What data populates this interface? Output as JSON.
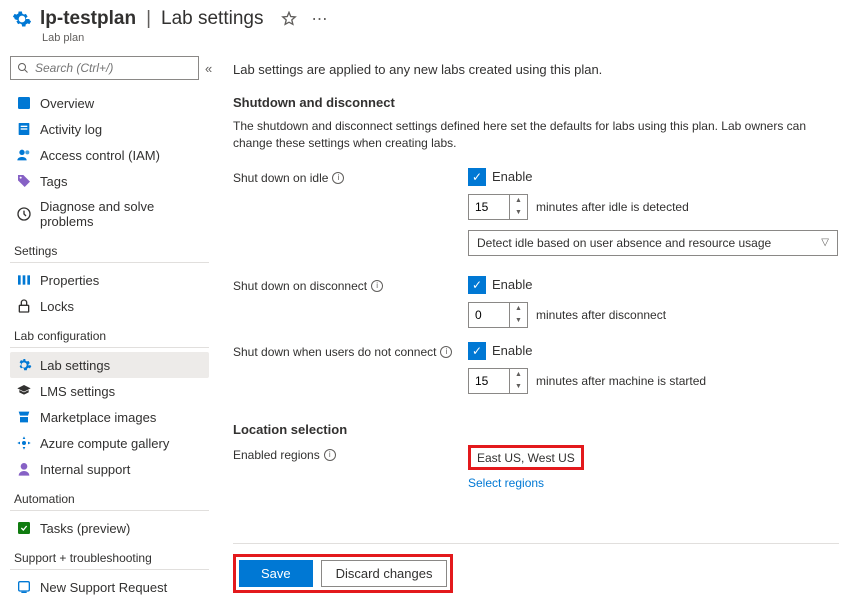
{
  "header": {
    "name": "lp-testplan",
    "section": "Lab settings",
    "resourceType": "Lab plan"
  },
  "search": {
    "placeholder": "Search (Ctrl+/)"
  },
  "sidebar": {
    "top": [
      {
        "label": "Overview",
        "icon": "overview"
      },
      {
        "label": "Activity log",
        "icon": "activity"
      },
      {
        "label": "Access control (IAM)",
        "icon": "access"
      },
      {
        "label": "Tags",
        "icon": "tags"
      },
      {
        "label": "Diagnose and solve problems",
        "icon": "diagnose"
      }
    ],
    "groups": [
      {
        "title": "Settings",
        "items": [
          {
            "label": "Properties",
            "icon": "properties"
          },
          {
            "label": "Locks",
            "icon": "locks"
          }
        ]
      },
      {
        "title": "Lab configuration",
        "items": [
          {
            "label": "Lab settings",
            "icon": "labsettings",
            "selected": true
          },
          {
            "label": "LMS settings",
            "icon": "lms"
          },
          {
            "label": "Marketplace images",
            "icon": "marketplace"
          },
          {
            "label": "Azure compute gallery",
            "icon": "gallery"
          },
          {
            "label": "Internal support",
            "icon": "support"
          }
        ]
      },
      {
        "title": "Automation",
        "items": [
          {
            "label": "Tasks (preview)",
            "icon": "tasks"
          }
        ]
      },
      {
        "title": "Support + troubleshooting",
        "items": [
          {
            "label": "New Support Request",
            "icon": "newsupport"
          }
        ]
      }
    ]
  },
  "main": {
    "intro": "Lab settings are applied to any new labs created using this plan.",
    "shutdown": {
      "head": "Shutdown and disconnect",
      "desc": "The shutdown and disconnect settings defined here set the defaults for labs using this plan. Lab owners can change these settings when creating labs.",
      "idle": {
        "label": "Shut down on idle",
        "enable": "Enable",
        "minutes": "15",
        "after": "minutes after idle is detected",
        "dropdown": "Detect idle based on user absence and resource usage"
      },
      "disconnect": {
        "label": "Shut down on disconnect",
        "enable": "Enable",
        "minutes": "0",
        "after": "minutes after disconnect"
      },
      "noconnect": {
        "label": "Shut down when users do not connect",
        "enable": "Enable",
        "minutes": "15",
        "after": "minutes after machine is started"
      }
    },
    "location": {
      "head": "Location selection",
      "label": "Enabled regions",
      "value": "East US, West US",
      "link": "Select regions"
    },
    "footer": {
      "save": "Save",
      "discard": "Discard changes"
    }
  }
}
